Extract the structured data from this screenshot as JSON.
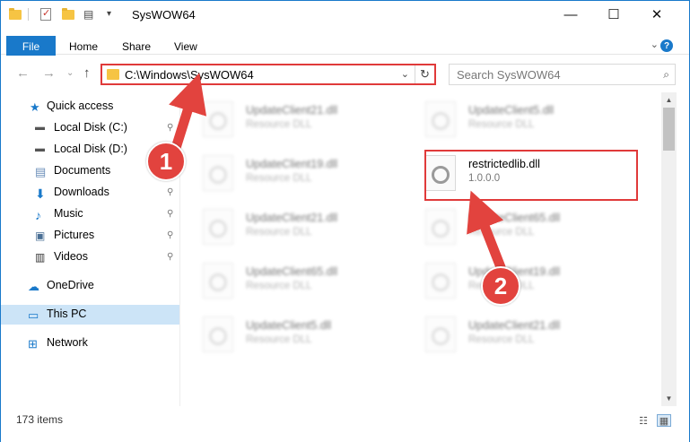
{
  "title_bar": {
    "title": "SysWOW64",
    "minimize": "—",
    "maximize": "☐",
    "close": "✕"
  },
  "ribbon": {
    "tabs": [
      {
        "label": "File"
      },
      {
        "label": "Home"
      },
      {
        "label": "Share"
      },
      {
        "label": "View"
      }
    ],
    "expand": "⌄",
    "help": "?"
  },
  "nav": {
    "back": "←",
    "forward": "→",
    "recent": "⌄",
    "up": "↑",
    "address": "C:\\Windows\\SysWOW64",
    "address_dropdown": "⌄",
    "refresh": "↻",
    "search_placeholder": "Search SysWOW64",
    "search_icon": "⌕"
  },
  "sidebar": {
    "items": [
      {
        "label": "Quick access",
        "icon": "star-icon",
        "pinned": false
      },
      {
        "label": "Local Disk (C:)",
        "icon": "drive-icon",
        "pinned": true
      },
      {
        "label": "Local Disk (D:)",
        "icon": "drive-icon",
        "pinned": true
      },
      {
        "label": "Documents",
        "icon": "documents-icon",
        "pinned": true
      },
      {
        "label": "Downloads",
        "icon": "downloads-icon",
        "pinned": true
      },
      {
        "label": "Music",
        "icon": "music-icon",
        "pinned": true
      },
      {
        "label": "Pictures",
        "icon": "pictures-icon",
        "pinned": true
      },
      {
        "label": "Videos",
        "icon": "videos-icon",
        "pinned": true
      },
      {
        "label": "OneDrive",
        "icon": "onedrive-icon",
        "pinned": false
      },
      {
        "label": "This PC",
        "icon": "this-pc-icon",
        "pinned": false
      },
      {
        "label": "Network",
        "icon": "network-icon",
        "pinned": false
      }
    ],
    "pin_glyph": "📌"
  },
  "files": [
    {
      "name": "UpdateClient21.dll",
      "sub": "Resource DLL"
    },
    {
      "name": "UpdateClient5.dll",
      "sub": "Resource DLL"
    },
    {
      "name": "UpdateClient19.dll",
      "sub": "Resource DLL"
    },
    {
      "name": "restrictedlib.dll",
      "sub": "1.0.0.0"
    },
    {
      "name": "UpdateClient21.dll",
      "sub": "Resource DLL"
    },
    {
      "name": "UpdateClient65.dll",
      "sub": "Resource DLL"
    },
    {
      "name": "UpdateClient65.dll",
      "sub": "Resource DLL"
    },
    {
      "name": "UpdateClient19.dll",
      "sub": "Resource DLL"
    },
    {
      "name": "UpdateClient5.dll",
      "sub": "Resource DLL"
    },
    {
      "name": "UpdateClient21.dll",
      "sub": "Resource DLL"
    }
  ],
  "annotations": {
    "step1": "1",
    "step2": "2",
    "colors": {
      "arrow": "#e2433e",
      "highlight": "#e03a3a"
    }
  },
  "status": {
    "items_count": "173 items",
    "details_view": "☷",
    "tiles_view": "▦"
  },
  "scrollbar": {
    "up": "▲",
    "down": "▼"
  }
}
